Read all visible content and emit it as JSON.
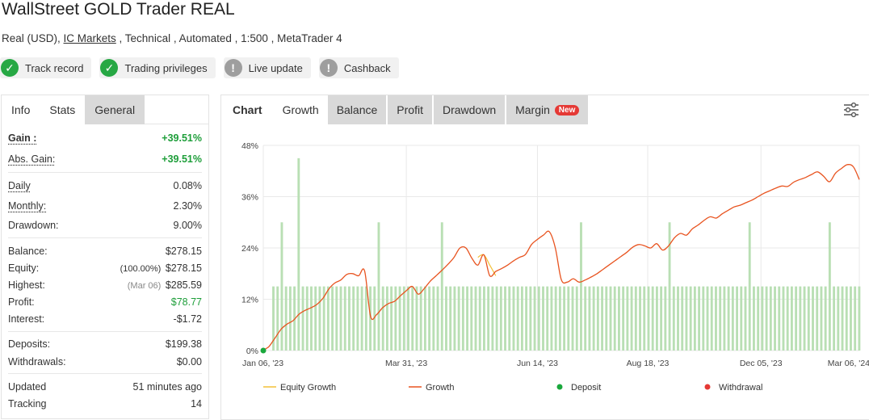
{
  "header": {
    "title": "WallStreet GOLD Trader REAL",
    "subtitle_prefix": "Real (USD), ",
    "broker_link": "IC Markets",
    "subtitle_suffix": " , Technical , Automated , 1:500 , MetaTrader 4"
  },
  "badges": [
    {
      "label": "Track record",
      "icon": "check-icon",
      "status": "green"
    },
    {
      "label": "Trading privileges",
      "icon": "check-icon",
      "status": "green"
    },
    {
      "label": "Live update",
      "icon": "exclamation-icon",
      "status": "grey"
    },
    {
      "label": "Cashback",
      "icon": "exclamation-icon",
      "status": "grey"
    }
  ],
  "left_tabs": [
    "Info",
    "Stats",
    "General"
  ],
  "stats": {
    "gain": {
      "label": "Gain :",
      "value": "+39.51%"
    },
    "abs_gain": {
      "label": "Abs. Gain:",
      "value": "+39.51%"
    },
    "daily": {
      "label": "Daily",
      "value": "0.08%"
    },
    "monthly": {
      "label": "Monthly:",
      "value": "2.30%"
    },
    "drawdown": {
      "label": "Drawdown:",
      "value": "9.00%"
    },
    "balance": {
      "label": "Balance:",
      "value": "$278.15"
    },
    "equity": {
      "label": "Equity:",
      "note": "(100.00%)",
      "value": "$278.15"
    },
    "highest": {
      "label": "Highest:",
      "note": "(Mar 06)",
      "value": "$285.59"
    },
    "profit": {
      "label": "Profit:",
      "value": "$78.77"
    },
    "interest": {
      "label": "Interest:",
      "value": "-$1.72"
    },
    "deposits": {
      "label": "Deposits:",
      "value": "$199.38"
    },
    "withdrawals": {
      "label": "Withdrawals:",
      "value": "$0.00"
    },
    "updated": {
      "label": "Updated",
      "value": "51 minutes ago"
    },
    "tracking": {
      "label": "Tracking",
      "value": "14"
    }
  },
  "right_tabs": {
    "chart_label": "Chart",
    "tabs": [
      "Growth",
      "Balance",
      "Profit",
      "Drawdown",
      "Margin"
    ],
    "new_badge": "New",
    "settings_icon": "sliders-icon"
  },
  "colors": {
    "green": "#27a844",
    "growth_line": "#e8531f",
    "equity_line": "#f2c037",
    "bars": "#b9dfb4",
    "deposit": "#1aa83c",
    "withdrawal": "#e53935"
  },
  "chart_data": {
    "type": "line",
    "title": "",
    "y_ticks": [
      "0%",
      "12%",
      "24%",
      "36%",
      "48%"
    ],
    "ylim": [
      0,
      48
    ],
    "x_ticks": [
      "Jan 06, '23",
      "Mar 31, '23",
      "Jun 14, '23",
      "Aug 18, '23",
      "Dec 05, '23",
      "Mar 06, '24"
    ],
    "legend": [
      "Equity Growth",
      "Growth",
      "Deposit",
      "Withdrawal"
    ],
    "series": [
      {
        "name": "Growth",
        "x": [
          0,
          0.5,
          1,
          2,
          3,
          4,
          5,
          6,
          7,
          8,
          9,
          10,
          11,
          12,
          13,
          14,
          15,
          16,
          17,
          18,
          19,
          20,
          21,
          22,
          23,
          24,
          25,
          26,
          27,
          28,
          29,
          30,
          31,
          32,
          33,
          34,
          35,
          36,
          37,
          38,
          39,
          40,
          41,
          42,
          43,
          44,
          45,
          46,
          47,
          48,
          49,
          50,
          51,
          52,
          53,
          54,
          55,
          56,
          57,
          58,
          59,
          60,
          61,
          62,
          63,
          64,
          65,
          66,
          67,
          68,
          69,
          70,
          71,
          72,
          73,
          74,
          75,
          76,
          77,
          78,
          79,
          80,
          81,
          82,
          83,
          84,
          85,
          86,
          87,
          88,
          89,
          90,
          91,
          92,
          93,
          94,
          95,
          96,
          97,
          98,
          99,
          100
        ],
        "values": [
          0,
          0.5,
          1.0,
          3.0,
          5.0,
          6.2,
          7.0,
          8.5,
          9.4,
          10.0,
          10.8,
          12.2,
          14.4,
          15.8,
          16.5,
          17.8,
          18.0,
          17.5,
          18.6,
          8.0,
          8.4,
          10.0,
          11.0,
          11.5,
          12.8,
          14.0,
          15.0,
          13.2,
          14.5,
          16.2,
          17.5,
          18.8,
          20.2,
          21.8,
          24.0,
          24.0,
          21.6,
          20.0,
          22.4,
          17.5,
          18.5,
          19.2,
          20.0,
          21.0,
          21.8,
          22.5,
          24.8,
          26.0,
          27.0,
          27.8,
          24.0,
          16.6,
          16.0,
          16.8,
          16.0,
          16.5,
          17.2,
          18.0,
          19.0,
          20.0,
          21.0,
          22.0,
          23.0,
          24.2,
          24.8,
          24.5,
          24.0,
          25.0,
          23.5,
          24.5,
          26.4,
          27.4,
          27.0,
          28.5,
          29.4,
          30.5,
          31.3,
          31.0,
          32.0,
          32.8,
          33.6,
          34.0,
          34.6,
          35.2,
          36.0,
          36.8,
          37.4,
          38.0,
          38.5,
          38.4,
          39.4,
          40.0,
          40.5,
          41.2,
          41.8,
          40.8,
          39.5,
          41.5,
          42.6,
          43.5,
          43.0,
          40.0
        ]
      },
      {
        "name": "Equity Growth",
        "x": [
          36,
          37,
          38,
          39
        ],
        "values": [
          21.8,
          22.4,
          20.0,
          17.5
        ]
      },
      {
        "name": "Deposit",
        "x": [
          0
        ],
        "values": [
          0
        ]
      }
    ],
    "bars": {
      "note": "transaction activity bars (relative heights in % axis units)",
      "values": [
        15,
        15,
        30,
        15,
        15,
        15,
        45,
        15,
        15,
        15,
        15,
        15,
        15,
        15,
        15,
        15,
        15,
        15,
        15,
        15,
        15,
        15,
        15,
        15,
        15,
        30,
        15,
        15,
        15,
        15,
        15,
        15,
        15,
        15,
        15,
        15,
        15,
        15,
        15,
        15,
        30,
        15,
        15,
        15,
        15,
        15,
        15,
        15,
        15,
        15,
        15,
        15,
        15,
        15,
        15,
        15,
        15,
        15,
        15,
        15,
        15,
        15,
        15,
        15,
        15,
        15,
        15,
        15,
        15,
        15,
        15,
        15,
        15,
        30,
        15,
        15,
        15,
        15,
        15,
        15,
        15,
        15,
        15,
        15,
        15,
        15,
        15,
        15,
        15,
        15,
        15,
        15,
        15,
        15,
        30,
        15,
        15,
        15,
        15,
        15,
        15,
        15,
        15,
        15,
        15,
        15,
        15,
        15,
        15,
        15,
        15,
        15,
        15,
        30,
        15,
        15,
        15,
        15,
        15,
        15,
        15,
        15,
        15,
        15,
        15,
        15,
        15,
        15,
        15,
        15,
        15,
        15,
        30,
        15,
        15,
        15,
        15,
        15,
        15,
        15
      ]
    }
  }
}
